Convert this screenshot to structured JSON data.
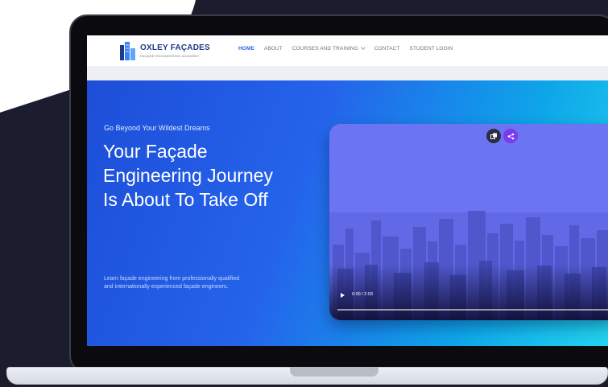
{
  "brand": {
    "name": "OXLEY FAÇADES",
    "tagline": "FAÇADE ENGINEERING ACADEMY",
    "color": "#1e3a8a"
  },
  "nav": {
    "items": [
      {
        "label": "HOME",
        "active": true
      },
      {
        "label": "ABOUT",
        "active": false
      },
      {
        "label": "COURSES AND TRAINING",
        "active": false,
        "has_dropdown": true
      },
      {
        "label": "CONTACT",
        "active": false
      },
      {
        "label": "STUDENT LOGIN",
        "active": false
      }
    ],
    "accent": "#2563eb"
  },
  "hero": {
    "eyebrow": "Go Beyond Your Wildest Dreams",
    "headline": [
      "Your Façade",
      "Engineering Journey",
      "Is About To Take Off"
    ],
    "description": [
      "Learn façade engineering from professionally qualified",
      "and internationally experienced façade engineers."
    ],
    "gradient_colors": [
      "#1d4ed8",
      "#2563eb",
      "#0ea5e9",
      "#22d3ee"
    ]
  },
  "video": {
    "time": "0:00 / 2:03",
    "progress": 0.0,
    "icons": [
      "play-icon",
      "copy-icon",
      "share-icon"
    ],
    "overlay_color": "#6b74f2"
  }
}
